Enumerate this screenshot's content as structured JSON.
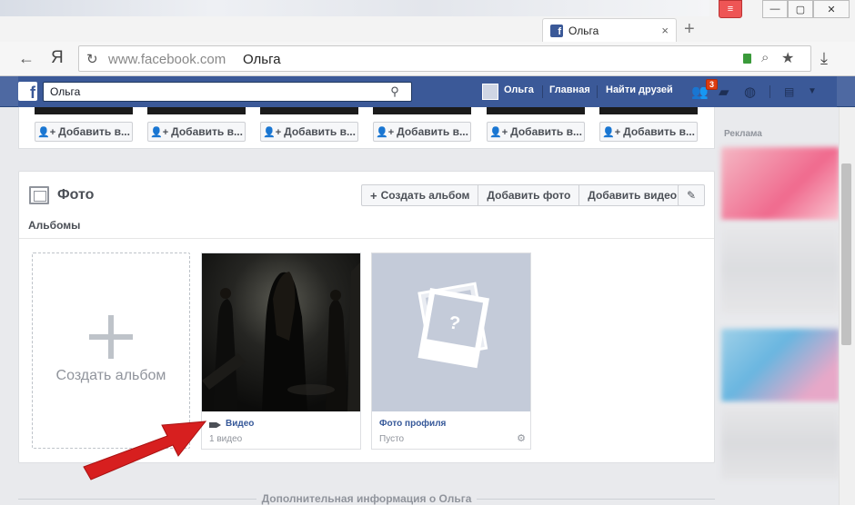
{
  "browser": {
    "tab_title": "Ольга",
    "tab_close": "×",
    "new_tab": "+",
    "back_icon": "←",
    "yandex_logo": "Я",
    "url": "www.facebook.com",
    "page_name": "Ольга",
    "window_min": "—",
    "window_max": "▢",
    "window_close": "✕",
    "download_icon": "⤓"
  },
  "facebook_nav": {
    "search_value": "Ольга",
    "user_name": "Ольга",
    "home": "Главная",
    "find_friends": "Найти друзей",
    "friend_requests_badge": "3",
    "logo": "f"
  },
  "friends_row": {
    "add_label": "Добавить в...",
    "count": 6
  },
  "photos": {
    "title": "Фото",
    "create_album_btn": "Создать альбом",
    "add_photo_btn": "Добавить фото",
    "add_video_btn": "Добавить видео",
    "albums_tab": "Альбомы",
    "create_album_tile": "Создать альбом",
    "albums": [
      {
        "name": "Видео",
        "sub": "1 видео"
      },
      {
        "name": "Фото профиля",
        "sub": "Пусто"
      }
    ]
  },
  "more_info": "Дополнительная информация о Ольга",
  "ads": {
    "title": "Реклама"
  },
  "colors": {
    "facebook_blue": "#3b5998",
    "arrow_red": "#d71f1f"
  }
}
